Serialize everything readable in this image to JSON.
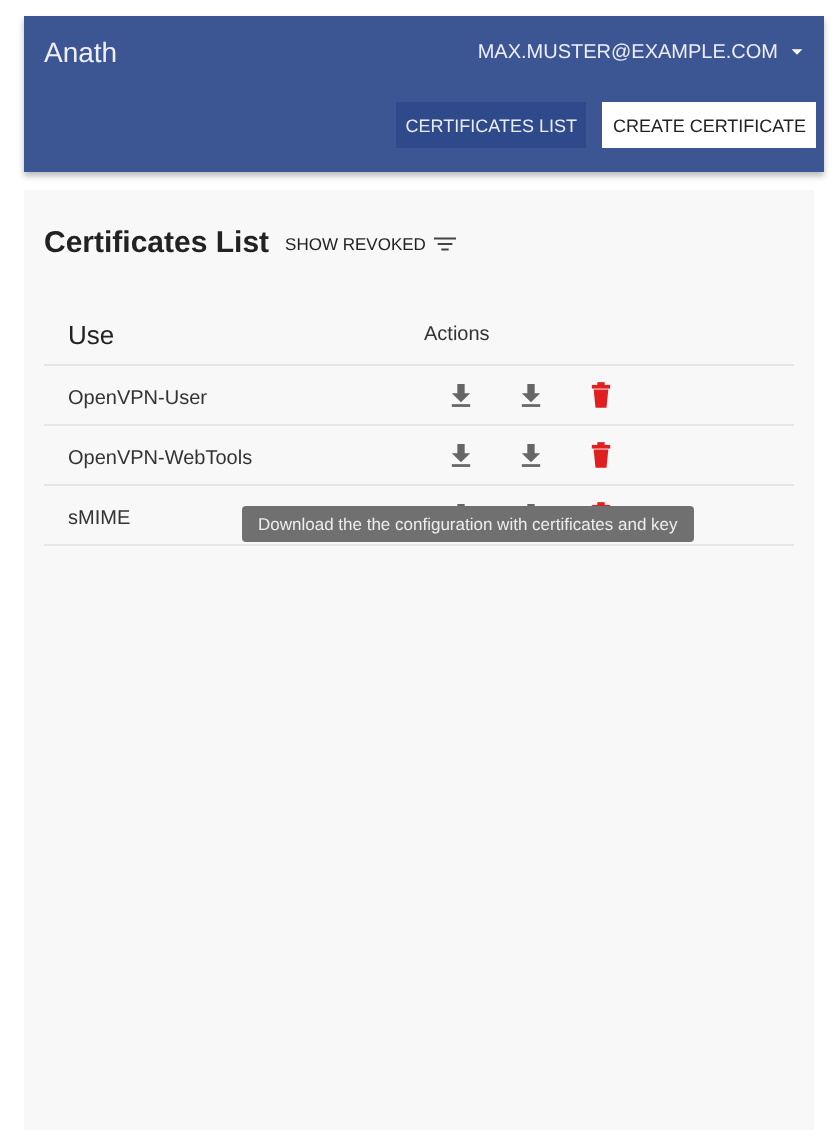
{
  "header": {
    "title": "Anath",
    "user_menu": "MAX.MUSTER@EXAMPLE.COM",
    "nav": [
      {
        "label": "CERTIFICATES LIST",
        "selected": true
      },
      {
        "label": "CREATE CERTIFICATE",
        "selected": false
      }
    ]
  },
  "page": {
    "title": "Certificates List",
    "filter_button": "SHOW REVOKED"
  },
  "table": {
    "columns": [
      "Use",
      "Actions"
    ],
    "rows": [
      {
        "use": "OpenVPN-User"
      },
      {
        "use": "OpenVPN-WebTools"
      },
      {
        "use": "sMIME",
        "tooltip": "Download the the configuration with certificates and key"
      }
    ]
  }
}
